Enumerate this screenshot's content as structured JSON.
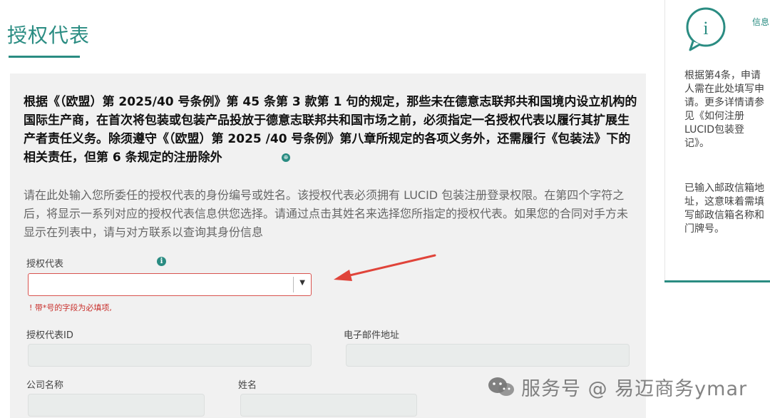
{
  "page": {
    "title": "授权代表"
  },
  "main": {
    "legal_text": "根据《（欧盟）第 2025/40 号条例》第 45 条第 3 款第 1 句的规定，那些未在德意志联邦共和国境内设立机构的国际生产商，在首次将包装或包装产品投放于德意志联邦共和国市场之前，必须指定一名授权代表以履行其扩展生产者责任义务。除须遵守《（欧盟）第 2025 /40 号条例》第八章所规定的各项义务外，还需履行《包装法》下的相关责任，但第 6 条规定的注册除外",
    "instructions": "请在此处输入您所委任的授权代表的身份编号或姓名。该授权代表必须拥有 LUCID 包装注册登录权限。在第四个字符之后，将显示一系列对应的授权代表信息供您选择。请通过点击其姓名来选择您所指定的授权代表。如果您的合同对手方未显示在列表中，请与对方联系以查询其身份信息"
  },
  "form": {
    "rep_label": "授权代表",
    "rep_info_icon": "i",
    "rep_select_value": "",
    "required_note": "! 带*号的字段为必填项,",
    "rep_id_label": "授权代表ID",
    "rep_id_value": "",
    "email_label": "电子邮件地址",
    "email_value": "",
    "company_label": "公司名称",
    "company_value": "",
    "name_label": "姓名",
    "name_value": ""
  },
  "sidebar": {
    "heading": "信息",
    "icon_letter": "i",
    "text1": "根据第4条，申请人需在此处填写申请。更多详情请参见《如何注册LUCID包装登记》。",
    "text2": "已输入邮政信箱地址，这意味着需填写邮政信箱名称和门牌号。"
  },
  "watermark": {
    "text": "服务号 @ 易迈商务ymar"
  },
  "icons": {
    "info": "info-icon",
    "dropdown": "caret-down-icon",
    "arrow": "red-arrow-annotation",
    "watermark_logo": "wechat-icon"
  },
  "colors": {
    "accent": "#2a8c82",
    "error": "#d9534f",
    "arrow": "#e0443a"
  }
}
